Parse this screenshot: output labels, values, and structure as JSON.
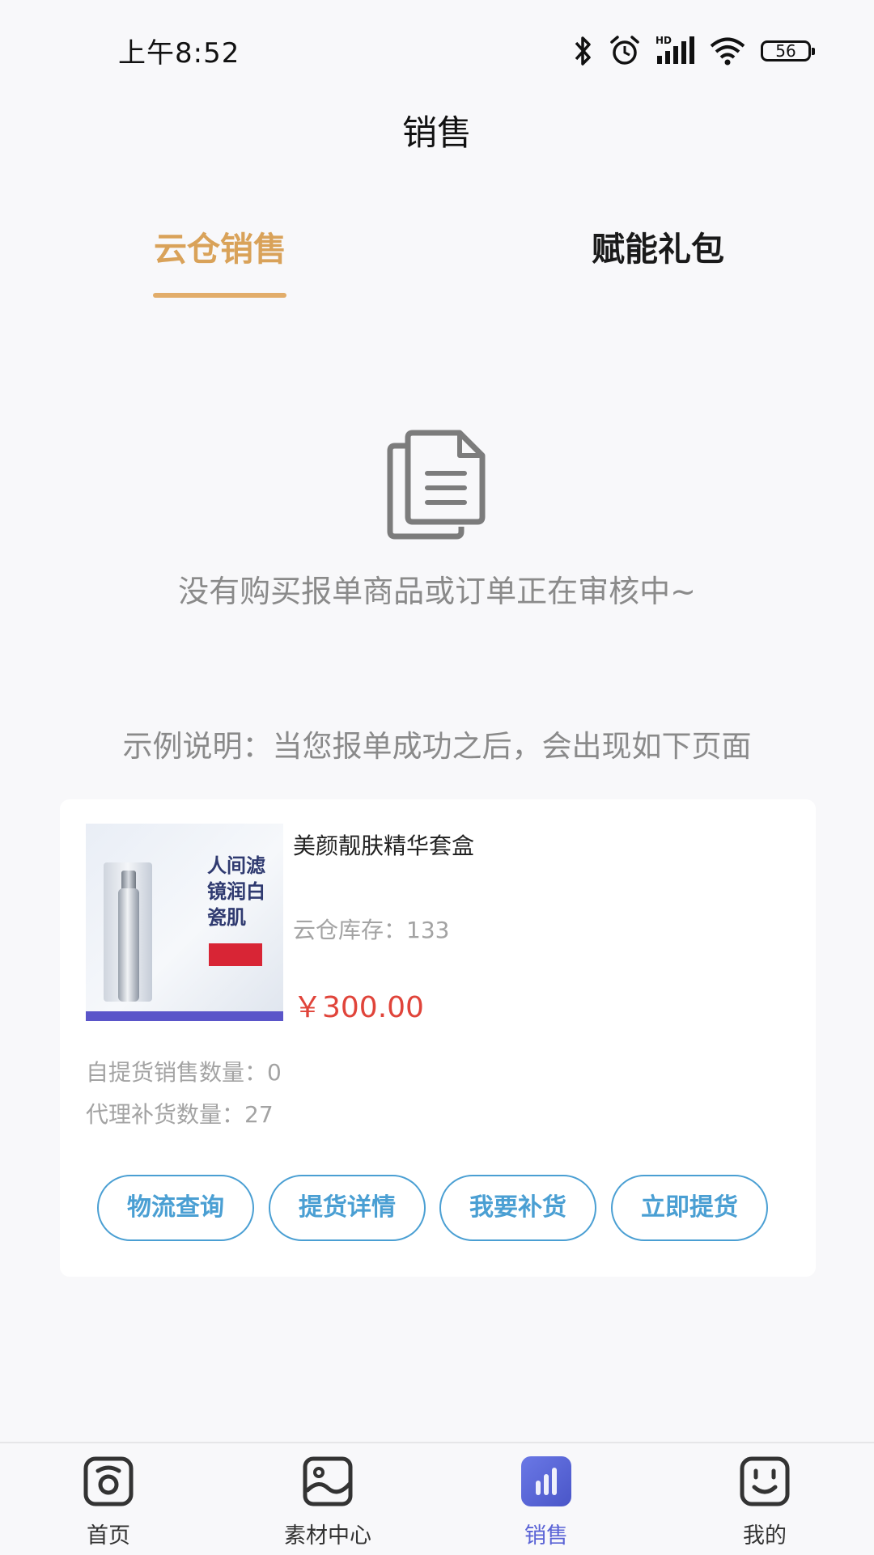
{
  "status_bar": {
    "time": "上午8:52",
    "battery": "56",
    "icons": [
      "bluetooth-icon",
      "alarm-icon",
      "hd-signal-icon",
      "wifi-icon",
      "battery-icon"
    ]
  },
  "header": {
    "title": "销售"
  },
  "tabs": [
    {
      "label": "云仓销售",
      "active": true
    },
    {
      "label": "赋能礼包",
      "active": false
    }
  ],
  "empty_state": {
    "icon": "document-copy-icon",
    "message": "没有购买报单商品或订单正在审核中~"
  },
  "example": {
    "caption": "示例说明：当您报单成功之后，会出现如下页面",
    "product": {
      "name": "美颜靓肤精华套盒",
      "stock": "云仓库存：133",
      "price": "￥300.00",
      "self_pickup_sales": "自提货销售数量：0",
      "agent_restock": "代理补货数量：27",
      "image_text": "人间滤镜润白瓷肌"
    },
    "actions": [
      "物流查询",
      "提货详情",
      "我要补货",
      "立即提货"
    ]
  },
  "bottom_nav": [
    {
      "label": "首页",
      "icon": "home-camera-icon",
      "active": false
    },
    {
      "label": "素材中心",
      "icon": "image-icon",
      "active": false
    },
    {
      "label": "销售",
      "icon": "bar-chart-icon",
      "active": true
    },
    {
      "label": "我的",
      "icon": "smiley-face-icon",
      "active": false
    }
  ],
  "colors": {
    "accent_tab": "#d9a259",
    "button_blue": "#4a9fd3",
    "price_red": "#e0443a",
    "nav_active": "#5a63d6"
  }
}
